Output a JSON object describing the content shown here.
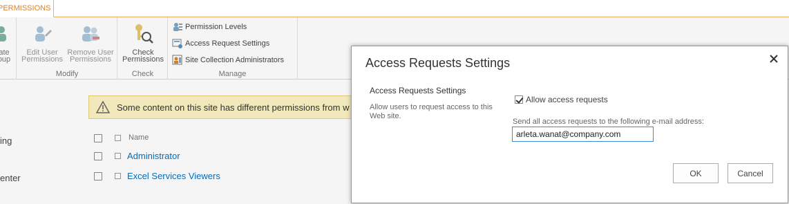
{
  "ribbon": {
    "active_tab": "PERMISSIONS",
    "create_group": {
      "label_line1": "ate",
      "label_line2": "oup"
    },
    "edit_user_permissions": {
      "line1": "Edit User",
      "line2": "Permissions"
    },
    "remove_user_permissions": {
      "line1": "Remove User",
      "line2": "Permissions"
    },
    "modify_group_label": "Modify",
    "check_permissions": {
      "line1": "Check",
      "line2": "Permissions"
    },
    "check_group_label": "Check",
    "manage_items": [
      "Permission Levels",
      "Access Request Settings",
      "Site Collection Administrators"
    ],
    "manage_group_label": "Manage"
  },
  "warning": {
    "text": "Some content on this site has different permissions from w"
  },
  "left_nav": [
    "ing",
    "enter"
  ],
  "list": {
    "column_name": "Name",
    "rows": [
      "Administrator",
      "Excel Services Viewers"
    ]
  },
  "dialog": {
    "title": "Access Requests Settings",
    "section_title": "Access Requests Settings",
    "section_description": "Allow users to request access to this Web site.",
    "allow_label": "Allow access requests",
    "allow_checked": true,
    "send_label": "Send all access requests to the following e-mail address:",
    "email_value": "arleta.wanat@company.com",
    "ok_label": "OK",
    "cancel_label": "Cancel"
  },
  "colors": {
    "accent": "#d9822b",
    "link": "#0072c6",
    "warning_bg": "#fbf3c4"
  }
}
